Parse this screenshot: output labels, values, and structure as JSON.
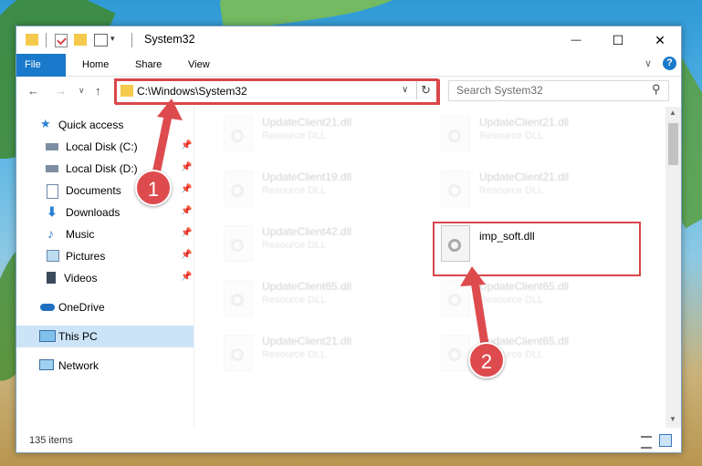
{
  "window": {
    "title": "System32",
    "minimize": "—",
    "maximize": "☐",
    "close": "✕"
  },
  "ribbon": {
    "tabs": [
      "File",
      "Home",
      "Share",
      "View"
    ],
    "expand": "∨",
    "help": "?"
  },
  "nav": {
    "back": "←",
    "forward": "→",
    "recent": "∨",
    "up": "↑",
    "address": "C:\\Windows\\System32",
    "dropdown": "∨",
    "refresh": "↻",
    "search_placeholder": "Search System32",
    "search_icon": "⚲"
  },
  "sidebar": {
    "items": [
      {
        "label": "Quick access",
        "icon": "star-icon",
        "pinned": false
      },
      {
        "label": "Local Disk (C:)",
        "icon": "drive-icon",
        "pinned": true
      },
      {
        "label": "Local Disk (D:)",
        "icon": "drive-icon",
        "pinned": true
      },
      {
        "label": "Documents",
        "icon": "documents-icon",
        "pinned": true
      },
      {
        "label": "Downloads",
        "icon": "download-icon",
        "pinned": true
      },
      {
        "label": "Music",
        "icon": "music-icon",
        "pinned": true
      },
      {
        "label": "Pictures",
        "icon": "pictures-icon",
        "pinned": true
      },
      {
        "label": "Videos",
        "icon": "videos-icon",
        "pinned": true
      },
      {
        "label": "OneDrive",
        "icon": "cloud-icon",
        "pinned": false
      },
      {
        "label": "This PC",
        "icon": "computer-icon",
        "pinned": false,
        "selected": true
      },
      {
        "label": "Network",
        "icon": "network-icon",
        "pinned": false
      }
    ],
    "pin_glyph": "📌"
  },
  "files": [
    {
      "name": "UpdateClient21.dll",
      "type": "Resource DLL"
    },
    {
      "name": "UpdateClient21.dll",
      "type": "Resource DLL"
    },
    {
      "name": "UpdateClient19.dll",
      "type": "Resource DLL"
    },
    {
      "name": "UpdateClient21.dll",
      "type": "Resource DLL"
    },
    {
      "name": "UpdateClient42.dll",
      "type": "Resource DLL"
    },
    {
      "name": "imp_soft.dll",
      "type": "",
      "highlighted": true
    },
    {
      "name": "UpdateClient65.dll",
      "type": "Resource DLL"
    },
    {
      "name": "UpdateClient65.dll",
      "type": "Resource DLL"
    },
    {
      "name": "UpdateClient21.dll",
      "type": "Resource DLL"
    },
    {
      "name": "UpdateClient65.dll",
      "type": "Resource DLL"
    }
  ],
  "status": {
    "item_count": "135 items"
  },
  "annotations": {
    "step1": "1",
    "step2": "2"
  },
  "colors": {
    "accent": "#1979ca",
    "highlight": "#d9474a",
    "selection": "#cce4f7"
  }
}
